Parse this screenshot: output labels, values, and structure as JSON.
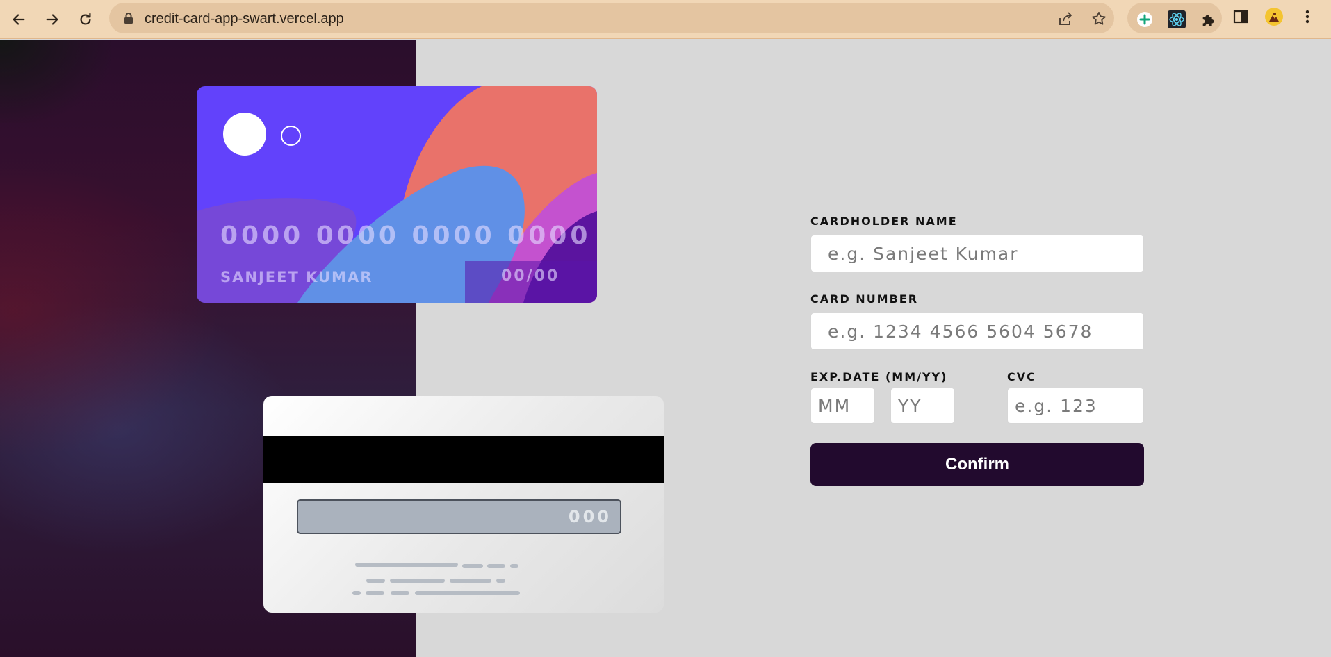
{
  "browser": {
    "url": "credit-card-app-swart.vercel.app",
    "icons": {
      "back": "arrow-left-icon",
      "forward": "arrow-right-icon",
      "reload": "reload-icon",
      "lock": "lock-icon",
      "share": "share-icon",
      "bookmark": "star-icon",
      "extensions": [
        "plus-extension-icon",
        "react-devtools-icon",
        "puzzle-icon"
      ],
      "side_panel": "side-panel-icon",
      "profile": "avatar",
      "menu": "kebab-menu-icon"
    }
  },
  "colors": {
    "chrome_bg": "#f1d7b6",
    "page_bg": "#d8d8d8",
    "card_front_bg": "#6242fb",
    "card_orange": "#e9726a",
    "card_blue": "#6090e6",
    "button_bg": "#220a2e"
  },
  "card_front": {
    "number": "0000 0000 0000 0000",
    "name": "SANJEET KUMAR",
    "expiry": "00/00"
  },
  "card_back": {
    "cvc": "000"
  },
  "form": {
    "name_label": "CARDHOLDER NAME",
    "name_placeholder": "e.g. Sanjeet Kumar",
    "number_label": "CARD NUMBER",
    "number_placeholder": "e.g. 1234 4566 5604 5678",
    "exp_label": "EXP.DATE (MM/YY)",
    "mm_placeholder": "MM",
    "yy_placeholder": "YY",
    "cvc_label": "CVC",
    "cvc_placeholder": "e.g. 123",
    "confirm_label": "Confirm"
  }
}
